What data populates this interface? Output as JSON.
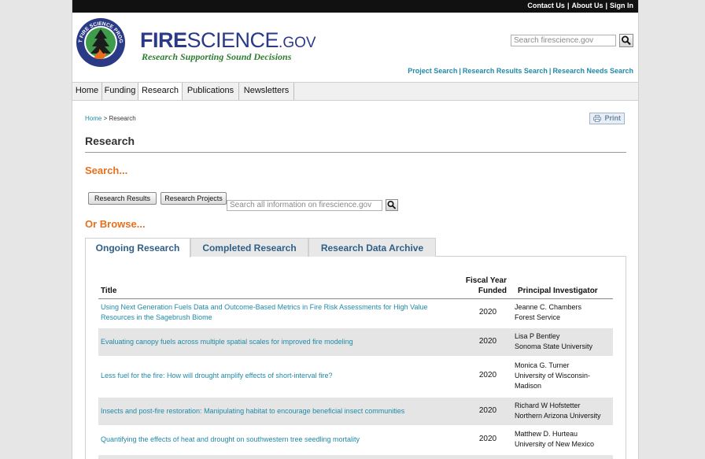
{
  "header": {
    "top_links": [
      "Contact Us",
      "About Us",
      "Sign In"
    ],
    "seal_text": "JOINT FIRE SCIENCE PROGRAM",
    "brand": {
      "part1": "FIRE",
      "part2": "SCIENCE",
      "part3": ".GOV"
    },
    "tagline": "Research Supporting Sound Decisions",
    "search_placeholder": "Search firescience.gov",
    "sub_links": [
      "Project Search",
      "Research Results Search",
      "Research Needs Search"
    ]
  },
  "nav": {
    "items": [
      "Home",
      "Funding",
      "Research",
      "Publications",
      "Newsletters"
    ],
    "active": "Research"
  },
  "breadcrumb": {
    "home": "Home",
    "separator": ">",
    "current": "Research"
  },
  "print_label": "Print",
  "page_title": "Research",
  "search_heading": "Search...",
  "buttons": {
    "results": "Research Results",
    "projects": "Research Projects"
  },
  "browse_search_placeholder": "Search all information on firescience.gov",
  "browse_heading": "Or Browse...",
  "tabs": [
    "Ongoing Research",
    "Completed Research",
    "Research Data Archive"
  ],
  "table": {
    "headers": {
      "title": "Title",
      "fiscal_year_line1": "Fiscal Year",
      "fiscal_year_line2": "Funded",
      "pi": "Principal Investigator"
    },
    "rows": [
      {
        "title_line1": "Using Next Generation Fuels Data and Outcome-Based Metrics in Fire Risk Assessments for High Value",
        "title_line2": "Resources in the Sagebrush Biome",
        "year": "2020",
        "pi_line1": "Jeanne C. Chambers",
        "pi_line2": "Forest Service",
        "pi_line3": ""
      },
      {
        "title_line1": "Evaluating canopy fuels across multiple spatial scales for improved fire modeling",
        "title_line2": "",
        "year": "2020",
        "pi_line1": "Lisa P Bentley",
        "pi_line2": "Sonoma State University",
        "pi_line3": ""
      },
      {
        "title_line1": "Less fuel for the fire: How will drought amplify effects of short-interval fire?",
        "title_line2": "",
        "year": "2020",
        "pi_line1": "Monica G. Turner",
        "pi_line2": "University of Wisconsin-",
        "pi_line3": "Madison"
      },
      {
        "title_line1": "Insects and post-fire restoration: Manipulating habitat to encourage beneficial insect communities",
        "title_line2": "",
        "year": "2020",
        "pi_line1": "Richard W Hofstetter",
        "pi_line2": "Northern Arizona University",
        "pi_line3": ""
      },
      {
        "title_line1": "Quantifying the effects of heat and drought on southwestern tree seedling mortality",
        "title_line2": "",
        "year": "2020",
        "pi_line1": "Matthew D. Hurteau",
        "pi_line2": "University of New Mexico",
        "pi_line3": ""
      }
    ]
  },
  "colors": {
    "brand_blue": "#2b3a86",
    "tagline_green": "#2e7d32",
    "link_teal": "#1f8aa8",
    "heading_orange": "#e8701c",
    "tab_text": "#2f5f87"
  }
}
